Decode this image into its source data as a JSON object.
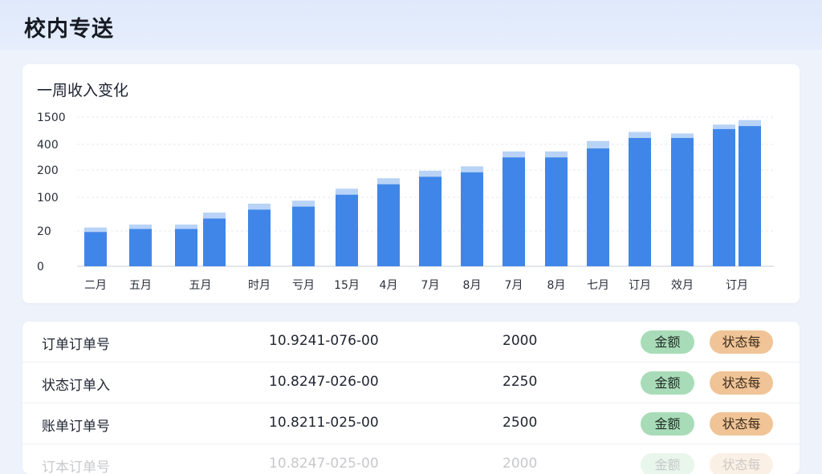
{
  "header": {
    "title": "校内专送"
  },
  "chart_data": {
    "type": "bar",
    "title": "一周收入变化",
    "yticks": [
      "0",
      "20",
      "100",
      "200",
      "400",
      "1500"
    ],
    "categories": [
      "二月",
      "",
      "五月",
      "",
      "五月",
      "时月",
      "亏月",
      "15月",
      "4月",
      "7月",
      "8月",
      "7月",
      "8月",
      "七月",
      "订月",
      "效月",
      "",
      "订月"
    ],
    "xtick_labels": [
      "二月",
      "五月",
      "五月",
      "时月",
      "亏月",
      "15月",
      "4月",
      "7月",
      "8月",
      "7月",
      "8月",
      "七月",
      "订月",
      "效月",
      "订月"
    ],
    "series": [
      {
        "values": [
          0.23,
          0.25,
          0.25,
          0.32,
          0.38,
          0.4,
          0.48,
          0.55,
          0.6,
          0.63,
          0.73,
          0.73,
          0.79,
          0.86,
          0.86,
          0.92,
          0.94
        ]
      },
      {
        "values": [
          0.03,
          0.03,
          0.03,
          0.04,
          0.04,
          0.04,
          0.04,
          0.04,
          0.04,
          0.04,
          0.04,
          0.04,
          0.05,
          0.04,
          0.03,
          0.03,
          0.04
        ]
      }
    ],
    "bar_groups": [
      1,
      1,
      2,
      1,
      1,
      1,
      1,
      1,
      1,
      1,
      1,
      1,
      1,
      1,
      2
    ],
    "colors": {
      "primary": "#3f86e8",
      "secondary": "#b9d3f7"
    },
    "grid": true
  },
  "orders": [
    {
      "name": "订单订单号",
      "number": "10.9241-076-00",
      "amount": "2000",
      "tag1": "金额",
      "tag2": "状态每"
    },
    {
      "name": "状态订单入",
      "number": "10.8247-026-00",
      "amount": "2250",
      "tag1": "金额",
      "tag2": "状态每"
    },
    {
      "name": "账单订单号",
      "number": "10.8211-025-00",
      "amount": "2500",
      "tag1": "金额",
      "tag2": "状态每"
    },
    {
      "name": "订本订单号",
      "number": "10.8247-025-00",
      "amount": "2000",
      "tag1": "金额",
      "tag2": "状态每"
    }
  ]
}
